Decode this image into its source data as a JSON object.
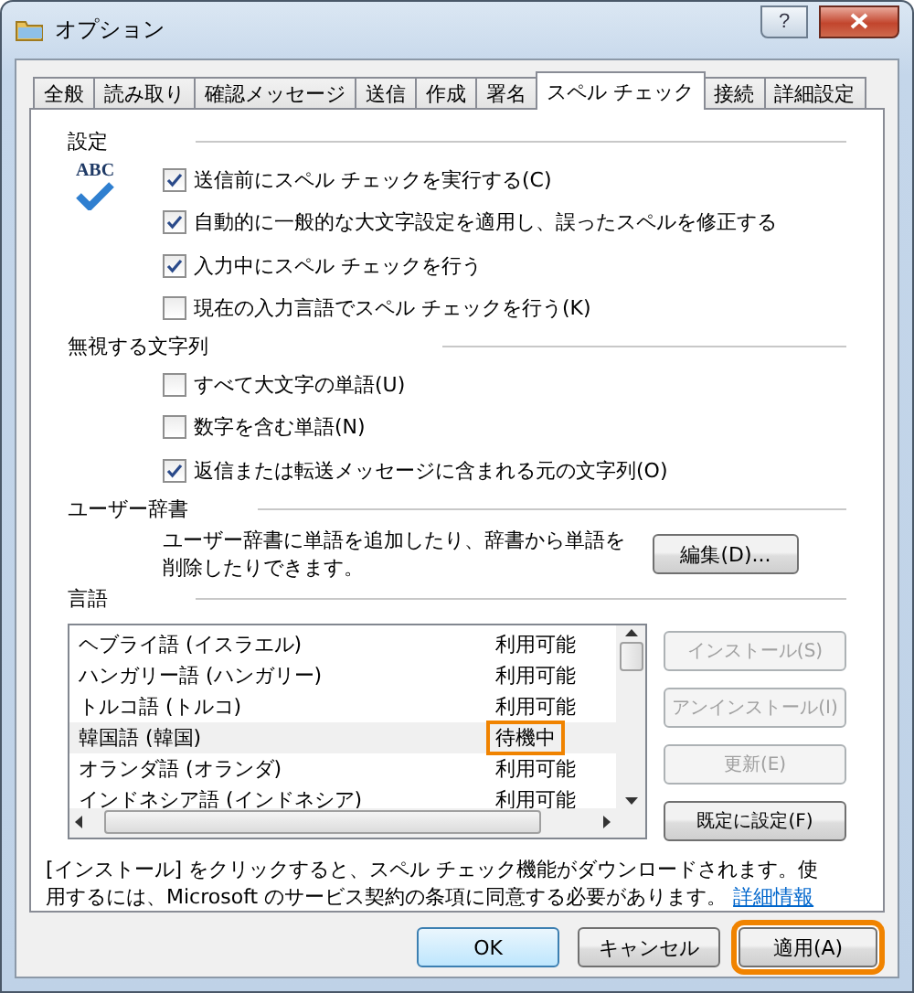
{
  "window": {
    "title": "オプション",
    "help": "?"
  },
  "tabs": [
    {
      "label": "全般",
      "selected": false
    },
    {
      "label": "読み取り",
      "selected": false
    },
    {
      "label": "確認メッセージ",
      "selected": false
    },
    {
      "label": "送信",
      "selected": false
    },
    {
      "label": "作成",
      "selected": false
    },
    {
      "label": "署名",
      "selected": false
    },
    {
      "label": "スペル チェック",
      "selected": true
    },
    {
      "label": "接続",
      "selected": false
    },
    {
      "label": "詳細設定",
      "selected": false
    }
  ],
  "settings": {
    "heading": "設定",
    "icon_text": "ABC",
    "options": [
      {
        "label": "送信前にスペル チェックを実行する(C)",
        "checked": true
      },
      {
        "label": "自動的に一般的な大文字設定を適用し、誤ったスペルを修正する",
        "checked": true
      },
      {
        "label": "入力中にスペル チェックを行う",
        "checked": true
      },
      {
        "label": "現在の入力言語でスペル チェックを行う(K)",
        "checked": false
      }
    ]
  },
  "ignore": {
    "heading": "無視する文字列",
    "options": [
      {
        "label": "すべて大文字の単語(U)",
        "checked": false
      },
      {
        "label": "数字を含む単語(N)",
        "checked": false
      },
      {
        "label": "返信または転送メッセージに含まれる元の文字列(O)",
        "checked": true
      }
    ]
  },
  "user_dictionary": {
    "heading": "ユーザー辞書",
    "description": "ユーザー辞書に単語を追加したり、辞書から単語を削除したりできます。",
    "button": "編集(D)..."
  },
  "languages": {
    "heading": "言語",
    "rows": [
      {
        "name": "ヘブライ語 (イスラエル)",
        "status": "利用可能",
        "selected": false,
        "highlighted": false
      },
      {
        "name": "ハンガリー語 (ハンガリー)",
        "status": "利用可能",
        "selected": false,
        "highlighted": false
      },
      {
        "name": "トルコ語 (トルコ)",
        "status": "利用可能",
        "selected": false,
        "highlighted": false
      },
      {
        "name": "韓国語 (韓国)",
        "status": "待機中",
        "selected": true,
        "highlighted": true
      },
      {
        "name": "オランダ語 (オランダ)",
        "status": "利用可能",
        "selected": false,
        "highlighted": false
      },
      {
        "name": "インドネシア語 (インドネシア)",
        "status": "利用可能",
        "selected": false,
        "highlighted": false
      }
    ],
    "buttons": [
      {
        "label": "インストール(S)",
        "disabled": true
      },
      {
        "label": "アンインストール(I)",
        "disabled": true
      },
      {
        "label": "更新(E)",
        "disabled": true
      },
      {
        "label": "既定に設定(F)",
        "disabled": false
      }
    ]
  },
  "notice": {
    "text": "[インストール] をクリックすると、スペル チェック機能がダウンロードされます。使用するには、Microsoft のサービス契約の条項に同意する必要があります。",
    "link": "詳細情報"
  },
  "footer_buttons": [
    {
      "label": "OK",
      "default": true,
      "highlighted": false
    },
    {
      "label": "キャンセル",
      "default": false,
      "highlighted": false
    },
    {
      "label": "適用(A)",
      "default": false,
      "highlighted": true
    }
  ]
}
